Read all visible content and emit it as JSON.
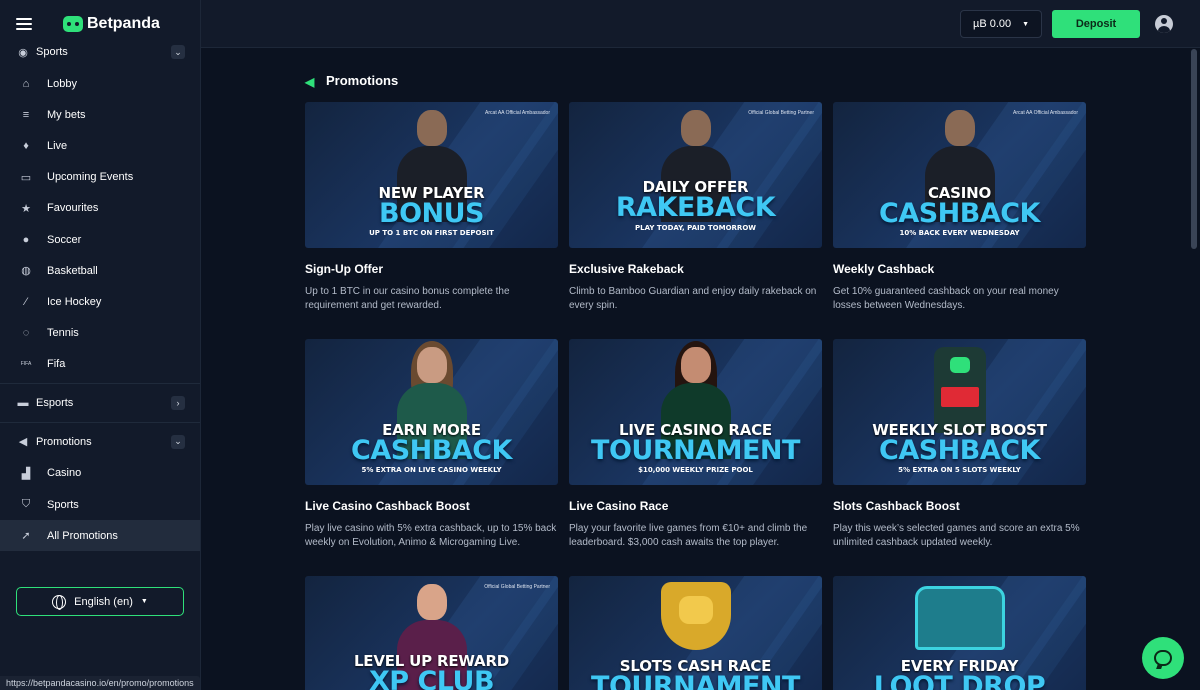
{
  "app": {
    "logo_text": "Betpanda"
  },
  "sidebar": {
    "sports_section": {
      "label": "Sports",
      "icon": "volleyball-icon"
    },
    "sports_items": [
      {
        "label": "Lobby",
        "icon": "home-icon"
      },
      {
        "label": "My bets",
        "icon": "coins-icon"
      },
      {
        "label": "Live",
        "icon": "microphone-icon"
      },
      {
        "label": "Upcoming Events",
        "icon": "calendar-icon"
      },
      {
        "label": "Favourites",
        "icon": "star-icon"
      },
      {
        "label": "Soccer",
        "icon": "soccer-ball-icon"
      },
      {
        "label": "Basketball",
        "icon": "basketball-icon"
      },
      {
        "label": "Ice Hockey",
        "icon": "hockey-stick-icon"
      },
      {
        "label": "Tennis",
        "icon": "tennis-icon"
      },
      {
        "label": "Fifa",
        "icon": "fifa-icon"
      }
    ],
    "esports_section": {
      "label": "Esports",
      "icon": "gamepad-icon"
    },
    "promotions_section": {
      "label": "Promotions",
      "icon": "megaphone-icon"
    },
    "promotions_items": [
      {
        "label": "Casino",
        "icon": "casino-icon"
      },
      {
        "label": "Sports",
        "icon": "shield-ball-icon"
      },
      {
        "label": "All Promotions",
        "icon": "rocket-icon"
      }
    ],
    "language": "English (en)"
  },
  "topbar": {
    "balance": "µB 0.00",
    "deposit_label": "Deposit"
  },
  "main": {
    "heading": "Promotions",
    "cards": [
      {
        "l1": "NEW PLAYER",
        "l2": "BONUS",
        "l3": "UP TO 1 BTC ON FIRST DEPOSIT",
        "tag": "Arcat AA Official Ambassador",
        "title": "Sign-Up Offer",
        "desc": "Up to 1 BTC in our casino bonus complete the requirement and get rewarded."
      },
      {
        "l1": "DAILY OFFER",
        "l2": "RAKEBACK",
        "l3": "PLAY TODAY, PAID TOMORROW",
        "tag": "Official Global Betting Partner",
        "title": "Exclusive Rakeback",
        "desc": "Climb to Bamboo Guardian and enjoy daily rakeback on every spin."
      },
      {
        "l1": "CASINO",
        "l2": "CASHBACK",
        "l3": "10% BACK EVERY WEDNESDAY",
        "tag": "Arcat AA Official Ambassador",
        "title": "Weekly Cashback",
        "desc": "Get 10% guaranteed cashback on your real money losses between Wednesdays."
      },
      {
        "l1": "EARN MORE",
        "l2": "CASHBACK",
        "l3": "5% EXTRA ON LIVE CASINO WEEKLY",
        "tag": "",
        "title": "Live Casino Cashback Boost",
        "desc": "Play live casino with 5% extra cashback, up to 15% back weekly on Evolution, Animo & Microgaming Live."
      },
      {
        "l1": "LIVE CASINO RACE",
        "l2": "TOURNAMENT",
        "l3": "$10,000 WEEKLY PRIZE POOL",
        "tag": "",
        "title": "Live Casino Race",
        "desc": "Play your favorite live games from €10+ and climb the leaderboard. $3,000 cash awaits the top player."
      },
      {
        "l1": "WEEKLY SLOT BOOST",
        "l2": "CASHBACK",
        "l3": "5% EXTRA ON 5 SLOTS WEEKLY",
        "tag": "",
        "title": "Slots Cashback Boost",
        "desc": "Play this week’s selected games and score an extra 5% unlimited cashback updated weekly."
      },
      {
        "l1": "LEVEL UP REWARD",
        "l2": "XP CLUB",
        "l3": "",
        "tag": "Official Global Betting Partner",
        "title": "",
        "desc": ""
      },
      {
        "l1": "SLOTS CASH RACE",
        "l2": "TOURNAMENT",
        "l3": "",
        "tag": "",
        "title": "",
        "desc": ""
      },
      {
        "l1": "EVERY FRIDAY",
        "l2": "LOOT DROP",
        "l3": "",
        "tag": "",
        "title": "",
        "desc": ""
      }
    ]
  },
  "status_bar": {
    "url": "https://betpandacasino.io/en/promo/promotions"
  }
}
